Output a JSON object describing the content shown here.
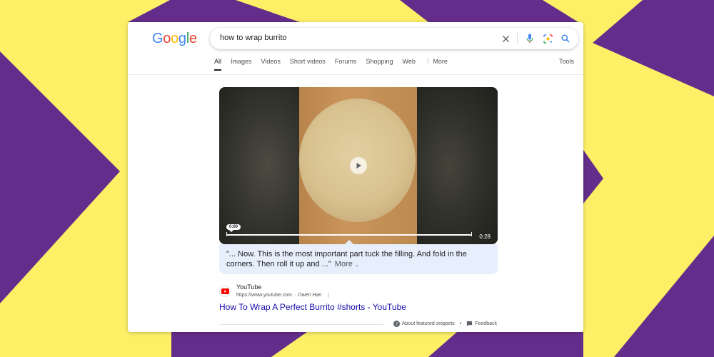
{
  "colors": {
    "background_yellow": "#fdf067",
    "background_purple": "#652d8b",
    "link_blue": "#1a0dab",
    "snippet_bg": "#e8effc"
  },
  "header": {
    "logo": [
      "G",
      "o",
      "o",
      "g",
      "l",
      "e"
    ],
    "logo_colors": [
      "#4285f4",
      "#ea4335",
      "#fbbc05",
      "#4285f4",
      "#34a853",
      "#ea4335"
    ],
    "search_value": "how to wrap burrito",
    "icons": [
      "clear-icon",
      "microphone-icon",
      "lens-icon",
      "search-icon"
    ]
  },
  "tabs": [
    {
      "label": "All",
      "active": true
    },
    {
      "label": "Images"
    },
    {
      "label": "Videos"
    },
    {
      "label": "Short videos"
    },
    {
      "label": "Forums"
    },
    {
      "label": "Shopping"
    },
    {
      "label": "Web"
    },
    {
      "label": "⋮ More"
    }
  ],
  "tools_label": "Tools",
  "video": {
    "timestamp": "0:00",
    "duration": "0:28",
    "progress_fraction": 0.0
  },
  "snippet": {
    "text": "\"... Now. This is the most important part tuck the filling. And fold in the corners. Then roll it up and ...\"",
    "more_label": "More"
  },
  "result": {
    "site_name": "YouTube",
    "url": "https://www.youtube.com",
    "separator": "·",
    "author": "Owen Han",
    "title": "How To Wrap A Perfect Burrito #shorts - YouTube"
  },
  "footer": {
    "about_label": "About featured snippets",
    "separator": "•",
    "feedback_label": "Feedback"
  }
}
